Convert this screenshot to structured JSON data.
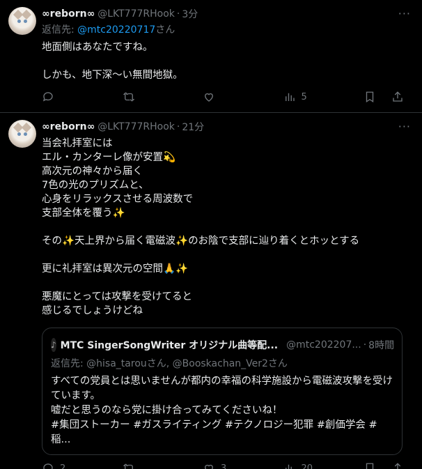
{
  "tweets": [
    {
      "name": "∞reborn∞",
      "handle": "@LKT777RHook",
      "time": "3分",
      "reply_prefix": "返信先: ",
      "reply_mention": "@mtc20220717",
      "reply_suffix": "さん",
      "body": "地面側はあなたですね。\n\nしかも、地下深〜い無間地獄。",
      "actions": {
        "reply": "",
        "retweet": "",
        "like": "",
        "views": "5"
      }
    },
    {
      "name": "∞reborn∞",
      "handle": "@LKT777RHook",
      "time": "21分",
      "body": "当会礼拝室には\nエル・カンターレ像が安置💫\n高次元の神々から届く\n7色の光のプリズムと、\n心身をリラックスさせる周波数で\n支部全体を覆う✨\n\nその✨天上界から届く電磁波✨のお陰で支部に辿り着くとホッとする\n\n更に礼拝室は異次元の空間🙏✨\n\n悪魔にとっては攻撃を受けてると\n感じるでしょうけどね",
      "quote": {
        "name": "MTC SingerSongWriter オリジナル曲等配...",
        "handle": "@mtc202207...",
        "time": "8時間",
        "reply": "返信先: @hisa_tarouさん, @Booskachan_Ver2さん",
        "body": "すべての党員とは思いませんが都内の幸福の科学施設から電磁波攻撃を受けています。\n嘘だと思うのなら党に掛け合ってみてくださいね！\n#集団ストーカー #ガスライティング #テクノロジー犯罪 #創価学会 #稲..."
      },
      "actions": {
        "reply": "2",
        "retweet": "",
        "like": "3",
        "views": "20"
      }
    }
  ],
  "icons": [
    "reply-icon",
    "retweet-icon",
    "like-icon",
    "views-icon",
    "bookmark-icon",
    "share-icon",
    "more-icon"
  ],
  "colors": {
    "background": "#000000",
    "text": "#e7e9ea",
    "muted": "#71767b",
    "link": "#1d9bf0",
    "border": "#2f3336"
  }
}
